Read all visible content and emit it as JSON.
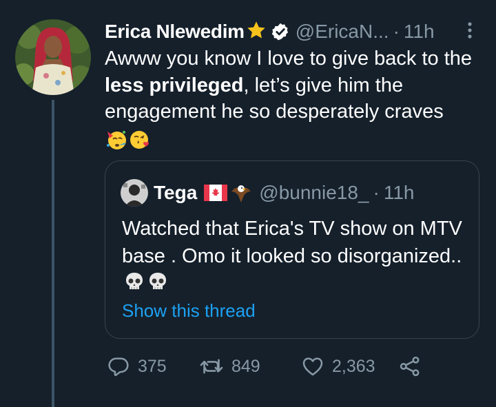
{
  "tweet": {
    "author_name": "Erica Nlewedim",
    "name_star_icon": "star-emoji",
    "verified_icon": "verified-badge-icon",
    "handle": "@EricaN...",
    "separator": "·",
    "time": "11h",
    "text_part1": "Awww you know I love to give back to the ",
    "text_bold": "less privileged",
    "text_part2": ", let’s give him the engagement he so desperately craves",
    "emojis": [
      "partying-face-emoji",
      "face-blowing-kiss-emoji"
    ]
  },
  "quoted_tweet": {
    "author_name": "Tega",
    "flag_icon": "canada-flag-emoji",
    "eagle_icon": "eagle-emoji",
    "handle": "@bunnie18_",
    "separator": "·",
    "time": "11h",
    "text": "Watched that Erica's TV show on MTV base . Omo it looked so disorganized..",
    "emojis": [
      "skull-emoji",
      "skull-emoji"
    ],
    "show_thread_label": "Show this thread"
  },
  "actions": {
    "reply_count": "375",
    "retweet_count": "849",
    "like_count": "2,363"
  },
  "colors": {
    "background": "#15202b",
    "text_primary": "#ffffff",
    "text_secondary": "#8899a6",
    "link": "#1da1f2",
    "border": "#38444d"
  }
}
